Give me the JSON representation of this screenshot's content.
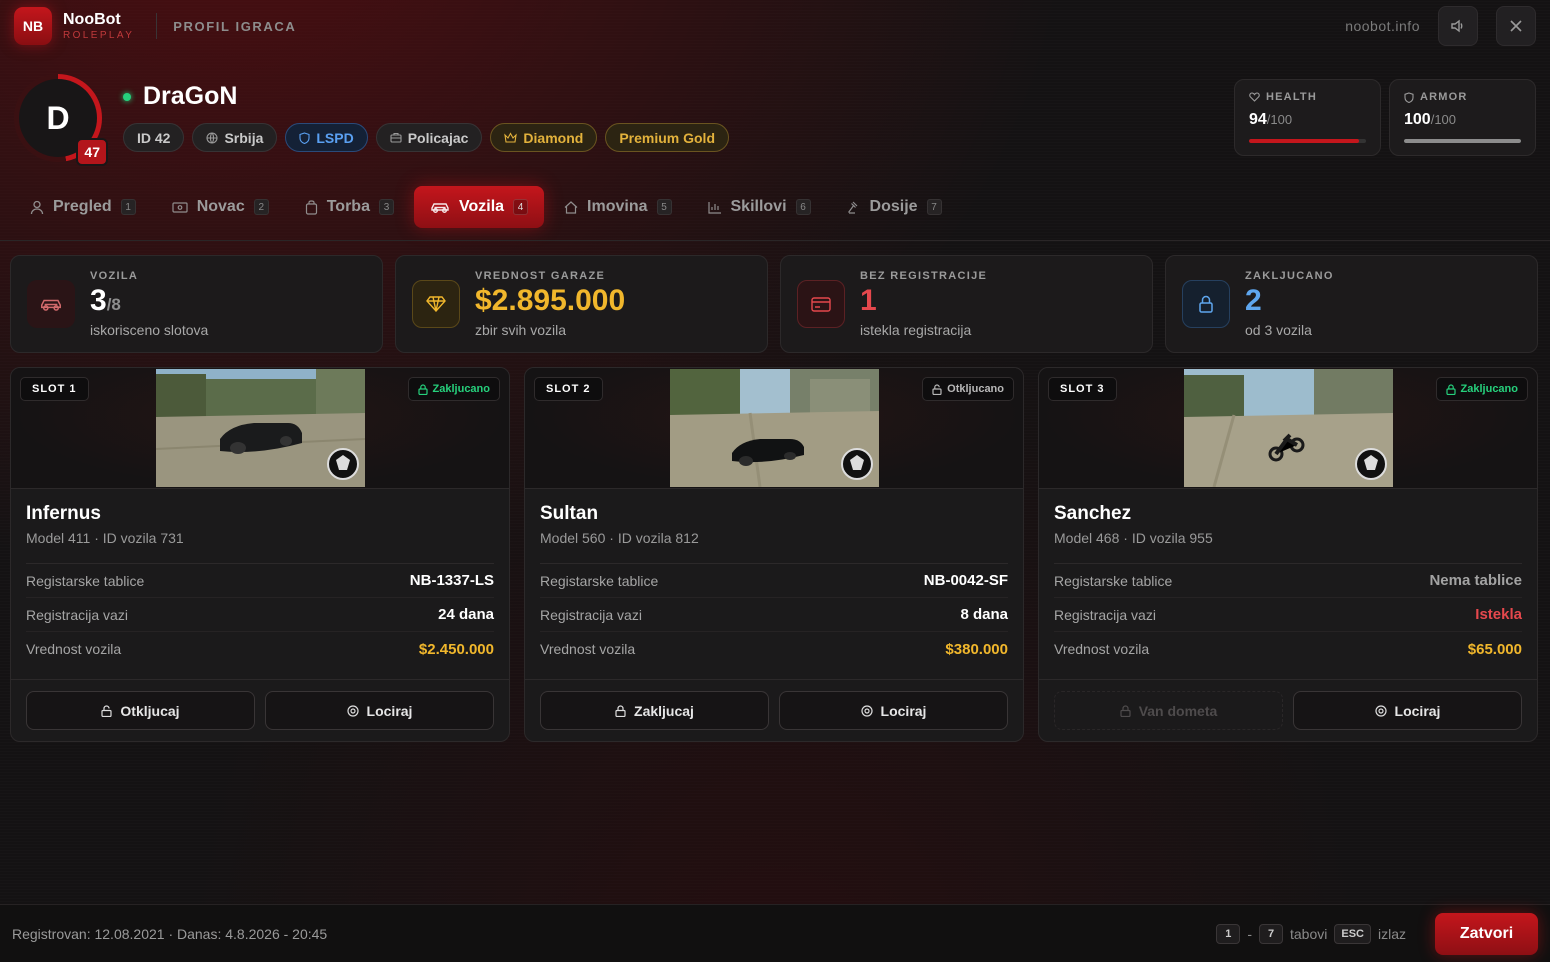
{
  "header": {
    "logo": "NB",
    "brand_name": "NooBot",
    "brand_sub": "ROLEPLAY",
    "page_label": "PROFIL IGRACA",
    "site": "noobot.info"
  },
  "player": {
    "initial": "D",
    "level": "47",
    "name": "DraGoN",
    "online": true,
    "tags": {
      "id": "ID 42",
      "country": "Srbija",
      "faction": "LSPD",
      "job": "Policajac",
      "vip": "Diamond",
      "premium": "Premium Gold"
    }
  },
  "stats": {
    "health": {
      "label": "HEALTH",
      "value": "94",
      "max": "/100",
      "fraction": 0.94,
      "color": "#c4161c"
    },
    "armor": {
      "label": "ARMOR",
      "value": "100",
      "max": "/100",
      "fraction": 1.0,
      "color": "#8c8c8c"
    }
  },
  "tabs": [
    {
      "label": "Pregled",
      "num": "1",
      "icon": "user-icon"
    },
    {
      "label": "Novac",
      "num": "2",
      "icon": "cash-icon"
    },
    {
      "label": "Torba",
      "num": "3",
      "icon": "bag-icon"
    },
    {
      "label": "Vozila",
      "num": "4",
      "icon": "car-icon",
      "active": true
    },
    {
      "label": "Imovina",
      "num": "5",
      "icon": "house-icon"
    },
    {
      "label": "Skillovi",
      "num": "6",
      "icon": "chart-icon"
    },
    {
      "label": "Dosije",
      "num": "7",
      "icon": "gavel-icon"
    }
  ],
  "summary": {
    "vehicles": {
      "label": "VOZILA",
      "value": "3",
      "max": "/8",
      "sub": "iskorisceno slotova",
      "color": "#ffffff"
    },
    "garage": {
      "label": "VREDNOST GARAZE",
      "value": "$2.895.000",
      "sub": "zbir svih vozila",
      "color": "#f1b72c"
    },
    "unregistered": {
      "label": "BEZ REGISTRACIJE",
      "value": "1",
      "sub": "istekla registracija",
      "color": "#e5484d"
    },
    "locked": {
      "label": "ZAKLJUCANO",
      "value": "2",
      "sub": "od 3 vozila",
      "color": "#5ea6ee"
    }
  },
  "vehicles": [
    {
      "slot": "SLOT 1",
      "lock_status": "Zakljucano",
      "locked": true,
      "name": "Infernus",
      "meta": "Model 411 · ID vozila 731",
      "plate_label": "Registarske tablice",
      "plate": "NB-1337-LS",
      "reg_label": "Registracija vazi",
      "reg": "24 dana",
      "value_label": "Vrednost vozila",
      "value": "$2.450.000",
      "action_primary": "Otkljucaj",
      "action_secondary": "Lociraj"
    },
    {
      "slot": "SLOT 2",
      "lock_status": "Otkljucano",
      "locked": false,
      "name": "Sultan",
      "meta": "Model 560 · ID vozila 812",
      "plate_label": "Registarske tablice",
      "plate": "NB-0042-SF",
      "reg_label": "Registracija vazi",
      "reg": "8 dana",
      "value_label": "Vrednost vozila",
      "value": "$380.000",
      "action_primary": "Zakljucaj",
      "action_secondary": "Lociraj"
    },
    {
      "slot": "SLOT 3",
      "lock_status": "Zakljucano",
      "locked": true,
      "name": "Sanchez",
      "meta": "Model 468 · ID vozila 955",
      "plate_label": "Registarske tablice",
      "plate": "Nema tablice",
      "reg_label": "Registracija vazi",
      "reg": "Istekla",
      "value_label": "Vrednost vozila",
      "value": "$65.000",
      "action_primary": "Van dometa",
      "action_secondary": "Lociraj"
    }
  ],
  "footer": {
    "registered": "Registrovan: 12.08.2021 · Danas: 4.8.2026 - 20:45",
    "key_from": "1",
    "dash": "-",
    "key_to": "7",
    "tabs_text": "tabovi",
    "esc_key": "ESC",
    "esc_text": "izlaz",
    "close_label": "Zatvori"
  },
  "colors": {
    "accent": "#c4161c",
    "gold": "#f1b72c",
    "green": "#26d07c",
    "red": "#e5484d",
    "blue": "#5ea6ee"
  }
}
